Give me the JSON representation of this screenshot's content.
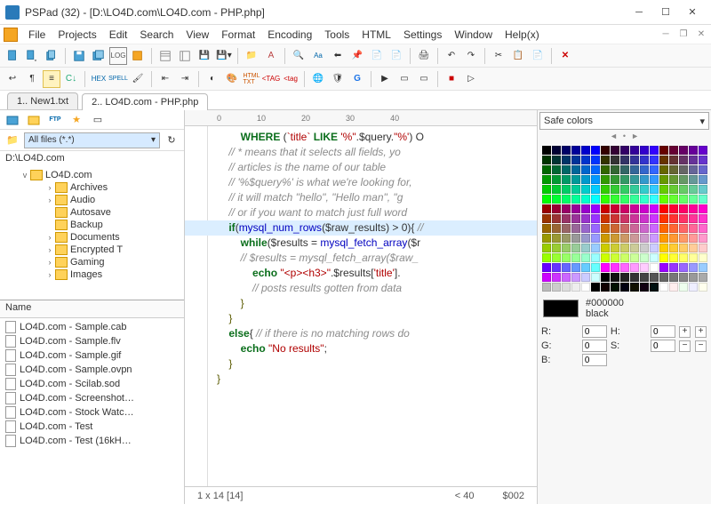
{
  "window": {
    "title": "PSPad (32) - [D:\\LO4D.com\\LO4D.com - PHP.php]"
  },
  "menu": [
    "File",
    "Projects",
    "Edit",
    "Search",
    "View",
    "Format",
    "Encoding",
    "Tools",
    "HTML",
    "Settings",
    "Window",
    "Help(x)"
  ],
  "tabs": [
    {
      "label": "1.. New1.txt",
      "active": false
    },
    {
      "label": "2.. LO4D.com - PHP.php",
      "active": true
    }
  ],
  "sidebar": {
    "filter_label": "All files (*.*)",
    "path": "D:\\LO4D.com",
    "root_folder": "LO4D.com",
    "folders": [
      "Archives",
      "Audio",
      "Autosave",
      "Backup",
      "Documents",
      "Encrypted T",
      "Gaming",
      "Images"
    ],
    "list_header": "Name",
    "files": [
      "LO4D.com - Sample.cab",
      "LO4D.com - Sample.flv",
      "LO4D.com - Sample.gif",
      "LO4D.com - Sample.ovpn",
      "LO4D.com - Scilab.sod",
      "LO4D.com - Screenshot…",
      "LO4D.com - Stock Watc…",
      "LO4D.com - Test",
      "LO4D.com - Test (16kH…"
    ]
  },
  "ruler": [
    "0",
    "10",
    "20",
    "30",
    "40"
  ],
  "code": {
    "lines": [
      {
        "t": "        WHERE (`title` LIKE '%\".$query.\"%') O",
        "cls": "kw"
      },
      {
        "t": ""
      },
      {
        "t": "    // * means that it selects all fields, yo",
        "cls": "cm"
      },
      {
        "t": "    // articles is the name of our table",
        "cls": "cm"
      },
      {
        "t": ""
      },
      {
        "t": "    // '%$query%' is what we're looking for,",
        "cls": "cm"
      },
      {
        "t": "    // it will match \"hello\", \"Hello man\", \"g",
        "cls": "cm"
      },
      {
        "t": "    // or if you want to match just full word",
        "cls": "cm"
      },
      {
        "t": ""
      },
      {
        "t": "    if(mysql_num_rows($raw_results) > 0){ //",
        "cls": "hl"
      },
      {
        "t": ""
      },
      {
        "t": "        while($results = mysql_fetch_array($r",
        "cls": "kw"
      },
      {
        "t": "        // $results = mysql_fetch_array($raw_",
        "cls": "cm"
      },
      {
        "t": ""
      },
      {
        "t": "            echo \"<p><h3>\".$results['title'].",
        "cls": "echo"
      },
      {
        "t": "            // posts results gotten from data",
        "cls": "cm"
      },
      {
        "t": "        }",
        "cls": "brace"
      },
      {
        "t": ""
      },
      {
        "t": "    }",
        "cls": "brace"
      },
      {
        "t": "    else{ // if there is no matching rows do",
        "cls": "else"
      },
      {
        "t": "        echo \"No results\";",
        "cls": "echo2"
      },
      {
        "t": "    }",
        "cls": "brace"
      },
      {
        "t": ""
      },
      {
        "t": "}",
        "cls": "brace"
      }
    ]
  },
  "statusbar": {
    "pos": "1 x 14 [14]",
    "col": "< 40",
    "extra": "$002"
  },
  "colorpanel": {
    "combo": "Safe colors",
    "hex": "#000000",
    "name": "black",
    "r": "0",
    "g": "0",
    "b": "0",
    "h": "0",
    "s": "0"
  },
  "palette": [
    "#000000",
    "#000033",
    "#000066",
    "#000099",
    "#0000cc",
    "#0000ff",
    "#330000",
    "#330033",
    "#330066",
    "#330099",
    "#3300cc",
    "#3300ff",
    "#660000",
    "#660033",
    "#660066",
    "#660099",
    "#6600cc",
    "#003300",
    "#003333",
    "#003366",
    "#003399",
    "#0033cc",
    "#0033ff",
    "#333300",
    "#333333",
    "#333366",
    "#333399",
    "#3333cc",
    "#3333ff",
    "#663300",
    "#663333",
    "#663366",
    "#663399",
    "#6633cc",
    "#006600",
    "#006633",
    "#006666",
    "#006699",
    "#0066cc",
    "#0066ff",
    "#336600",
    "#336633",
    "#336666",
    "#336699",
    "#3366cc",
    "#3366ff",
    "#666600",
    "#666633",
    "#666666",
    "#666699",
    "#6666cc",
    "#009900",
    "#009933",
    "#009966",
    "#009999",
    "#0099cc",
    "#0099ff",
    "#339900",
    "#339933",
    "#339966",
    "#339999",
    "#3399cc",
    "#3399ff",
    "#669900",
    "#669933",
    "#669966",
    "#669999",
    "#6699cc",
    "#00cc00",
    "#00cc33",
    "#00cc66",
    "#00cc99",
    "#00cccc",
    "#00ccff",
    "#33cc00",
    "#33cc33",
    "#33cc66",
    "#33cc99",
    "#33cccc",
    "#33ccff",
    "#66cc00",
    "#66cc33",
    "#66cc66",
    "#66cc99",
    "#66cccc",
    "#00ff00",
    "#00ff33",
    "#00ff66",
    "#00ff99",
    "#00ffcc",
    "#00ffff",
    "#33ff00",
    "#33ff33",
    "#33ff66",
    "#33ff99",
    "#33ffcc",
    "#33ffff",
    "#66ff00",
    "#66ff33",
    "#66ff66",
    "#66ff99",
    "#66ffcc",
    "#990000",
    "#990033",
    "#990066",
    "#990099",
    "#9900cc",
    "#9900ff",
    "#cc0000",
    "#cc0033",
    "#cc0066",
    "#cc0099",
    "#cc00cc",
    "#cc00ff",
    "#ff0000",
    "#ff0033",
    "#ff0066",
    "#ff0099",
    "#ff00cc",
    "#993300",
    "#993333",
    "#993366",
    "#993399",
    "#9933cc",
    "#9933ff",
    "#cc3300",
    "#cc3333",
    "#cc3366",
    "#cc3399",
    "#cc33cc",
    "#cc33ff",
    "#ff3300",
    "#ff3333",
    "#ff3366",
    "#ff3399",
    "#ff33cc",
    "#996600",
    "#996633",
    "#996666",
    "#996699",
    "#9966cc",
    "#9966ff",
    "#cc6600",
    "#cc6633",
    "#cc6666",
    "#cc6699",
    "#cc66cc",
    "#cc66ff",
    "#ff6600",
    "#ff6633",
    "#ff6666",
    "#ff6699",
    "#ff66cc",
    "#999900",
    "#999933",
    "#999966",
    "#999999",
    "#9999cc",
    "#9999ff",
    "#cc9900",
    "#cc9933",
    "#cc9966",
    "#cc9999",
    "#cc99cc",
    "#cc99ff",
    "#ff9900",
    "#ff9933",
    "#ff9966",
    "#ff9999",
    "#ff99cc",
    "#99cc00",
    "#99cc33",
    "#99cc66",
    "#99cc99",
    "#99cccc",
    "#99ccff",
    "#cccc00",
    "#cccc33",
    "#cccc66",
    "#cccc99",
    "#cccccc",
    "#ccccff",
    "#ffcc00",
    "#ffcc33",
    "#ffcc66",
    "#ffcc99",
    "#ffcccc",
    "#99ff00",
    "#99ff33",
    "#99ff66",
    "#99ff99",
    "#99ffcc",
    "#99ffff",
    "#ccff00",
    "#ccff33",
    "#ccff66",
    "#ccff99",
    "#ccffcc",
    "#ccffff",
    "#ffff00",
    "#ffff33",
    "#ffff66",
    "#ffff99",
    "#ffffcc",
    "#6600ff",
    "#6633ff",
    "#6666ff",
    "#6699ff",
    "#66ccff",
    "#66ffff",
    "#ff00ff",
    "#ff33ff",
    "#ff66ff",
    "#ff99ff",
    "#ffccff",
    "#ffffff",
    "#9900ff",
    "#9933ff",
    "#9966ff",
    "#9999ff",
    "#99ccff",
    "#cc00ff",
    "#cc33ff",
    "#cc66ff",
    "#cc99ff",
    "#ccccff",
    "#ccffff",
    "#000000",
    "#111111",
    "#222222",
    "#333333",
    "#444444",
    "#555555",
    "#666666",
    "#777777",
    "#888888",
    "#999999",
    "#aaaaaa",
    "#bbbbbb",
    "#cccccc",
    "#dddddd",
    "#eeeeee",
    "#ffffff",
    "#000000",
    "#110000",
    "#001100",
    "#000011",
    "#111100",
    "#110011",
    "#001111",
    "#ffffff",
    "#ffeeee",
    "#eeffee",
    "#eeeeff",
    "#ffffee"
  ]
}
